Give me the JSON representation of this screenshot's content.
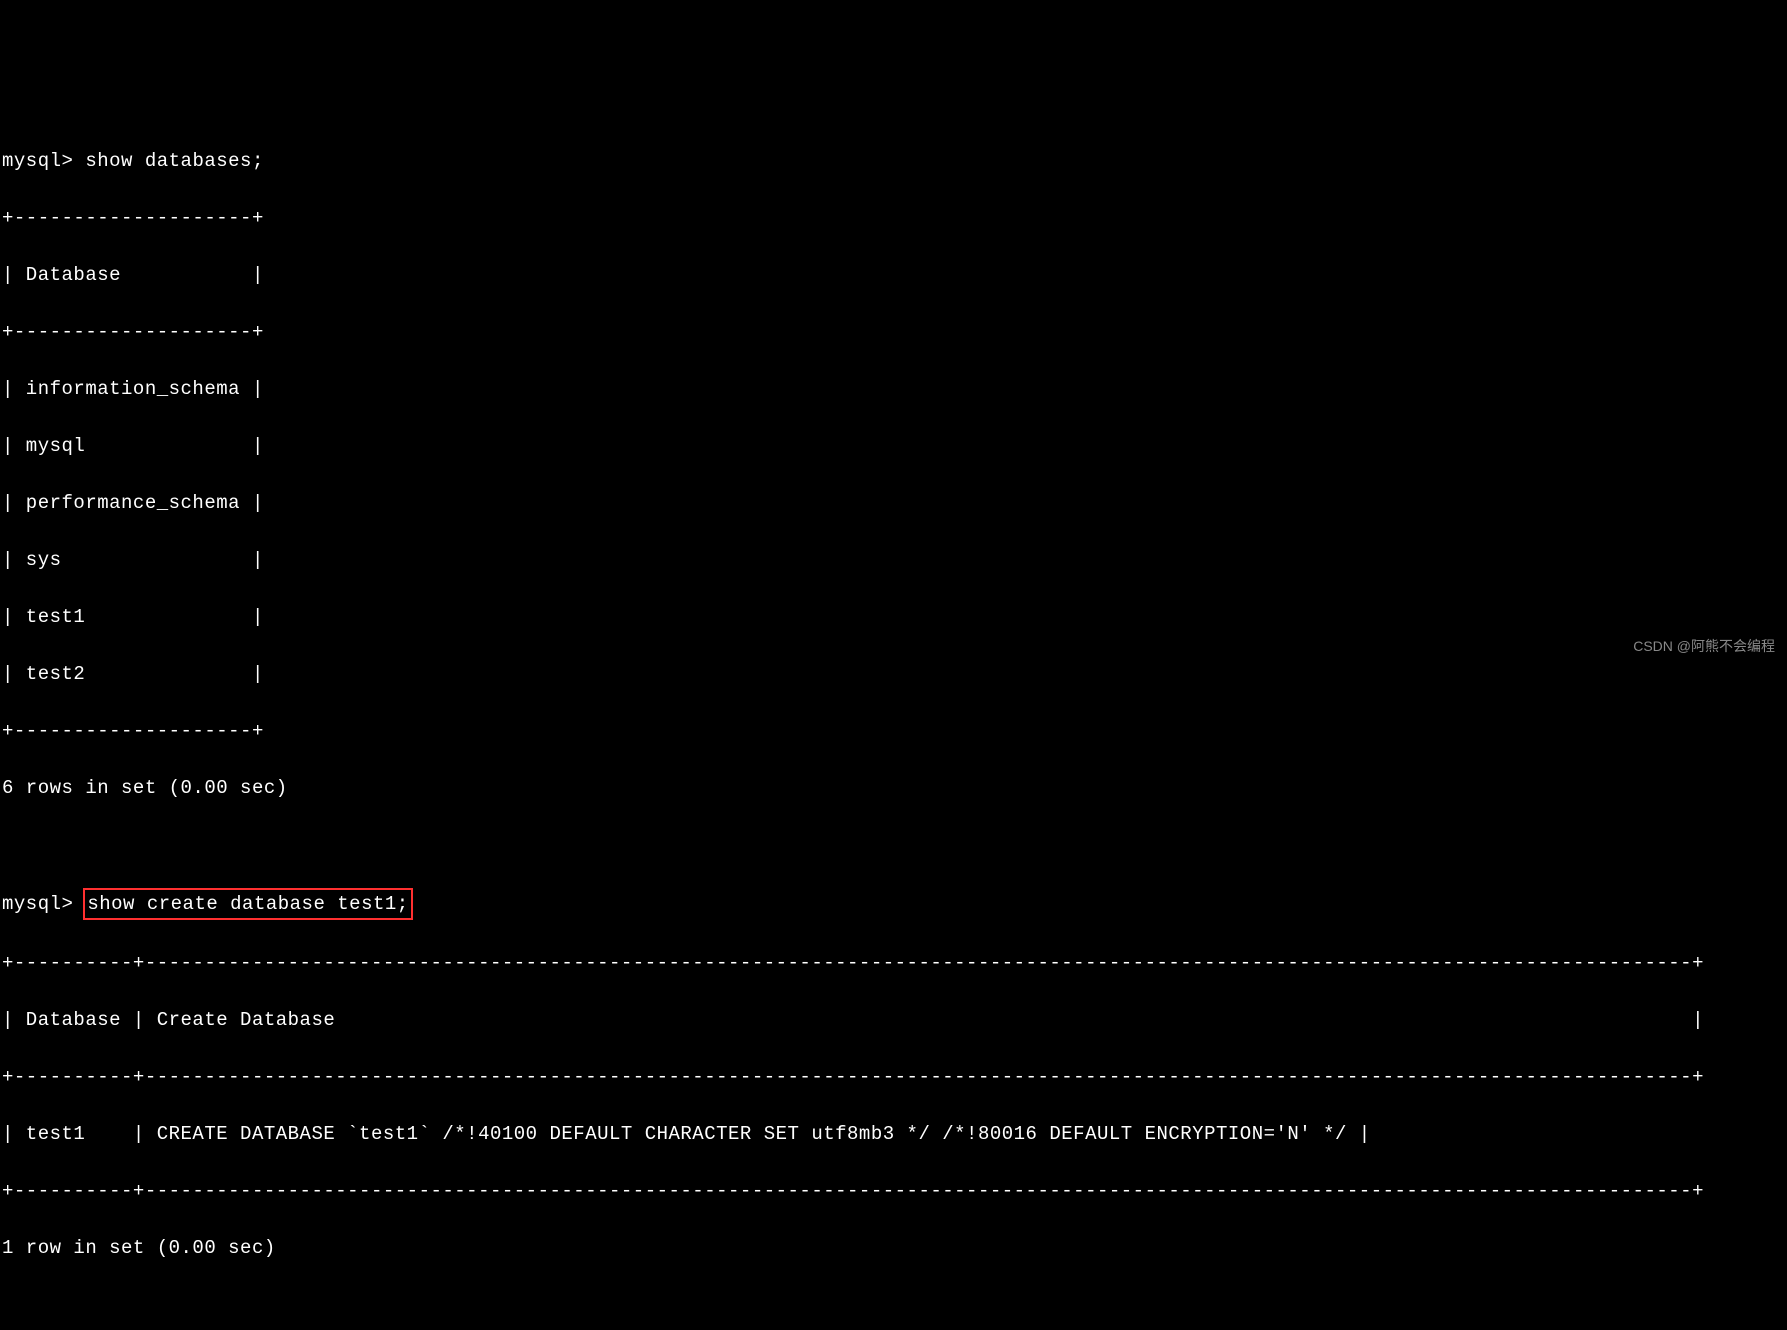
{
  "prompt": "mysql> ",
  "query1": {
    "command": "show databases;",
    "table_border_top": "+--------------------+",
    "table_header": "| Database           |",
    "table_border_mid": "+--------------------+",
    "rows": [
      "| information_schema |",
      "| mysql              |",
      "| performance_schema |",
      "| sys                |",
      "| test1              |",
      "| test2              |"
    ],
    "table_border_bot": "+--------------------+",
    "result": "6 rows in set (0.00 sec)"
  },
  "query2": {
    "command": "show create database test1;",
    "table_border_top": "+----------+----------------------------------------------------------------------------------------------------------------------------------+",
    "table_header": "| Database | Create Database                                                                                                                  |",
    "table_border_mid": "+----------+----------------------------------------------------------------------------------------------------------------------------------+",
    "rows": [
      "| test1    | CREATE DATABASE `test1` /*!40100 DEFAULT CHARACTER SET utf8mb3 */ /*!80016 DEFAULT ENCRYPTION='N' */ |"
    ],
    "table_border_bot": "+----------+----------------------------------------------------------------------------------------------------------------------------------+",
    "result": "1 row in set (0.00 sec)"
  },
  "watermark": "CSDN @阿熊不会编程"
}
